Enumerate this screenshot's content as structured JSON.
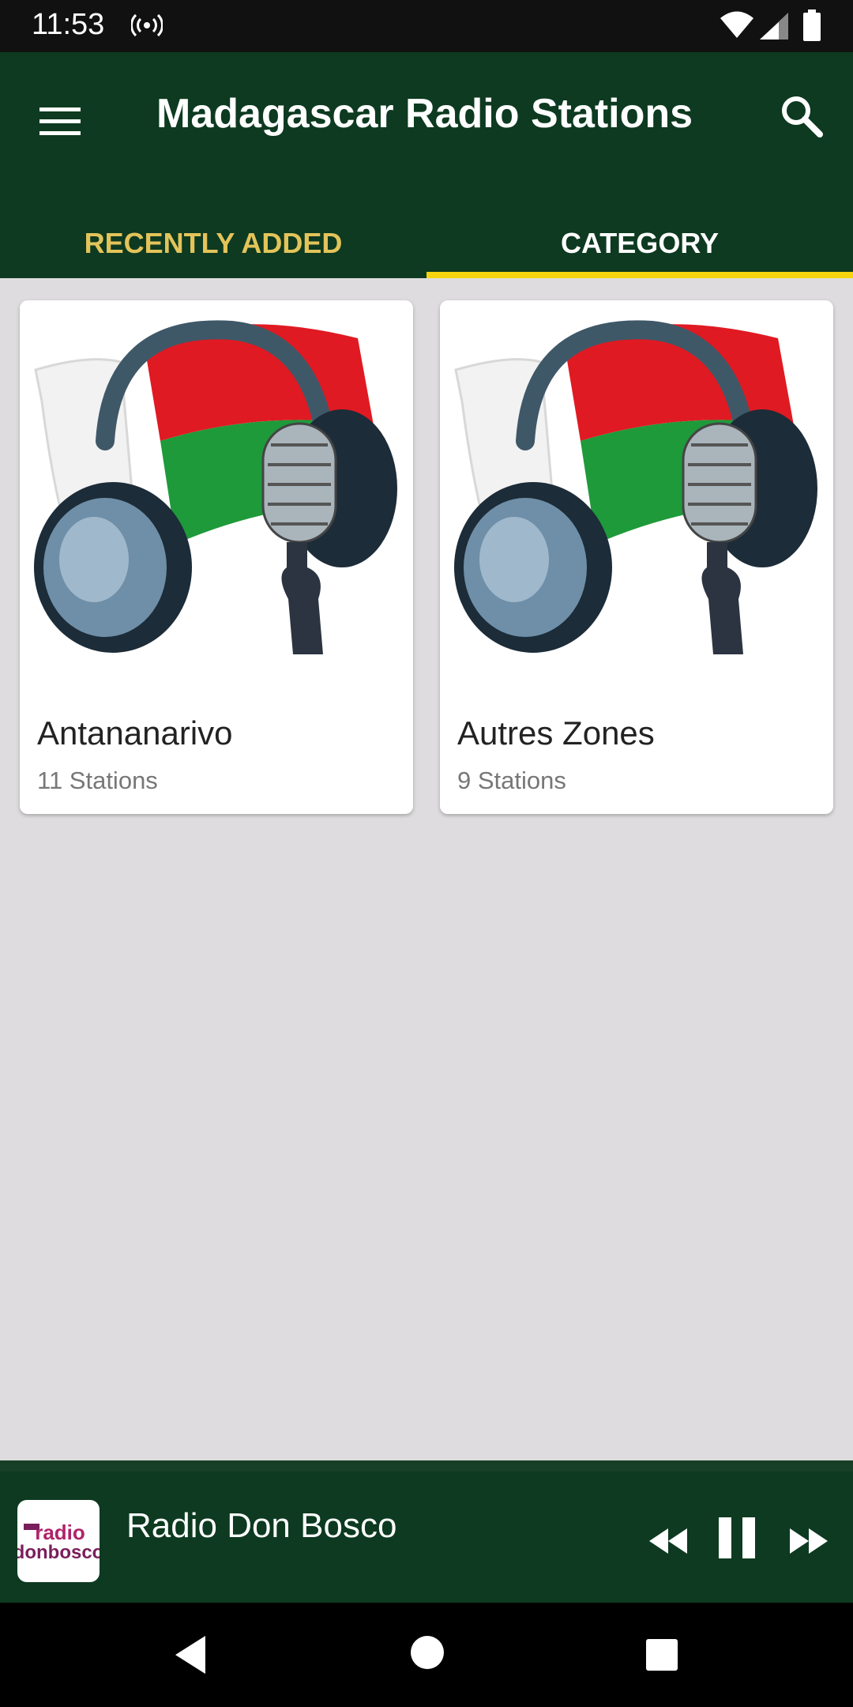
{
  "status_bar": {
    "time": "11:53",
    "icons": [
      "radio-broadcast-icon",
      "wifi-icon",
      "cell-signal-icon",
      "battery-icon"
    ]
  },
  "app_bar": {
    "title": "Madagascar Radio Stations",
    "menu_icon": "hamburger-menu-icon",
    "search_icon": "search-icon",
    "background_color": "#0d3a20"
  },
  "tabs": [
    {
      "label": "RECENTLY ADDED",
      "active": false,
      "color": "#e3c35a"
    },
    {
      "label": "CATEGORY",
      "active": true,
      "color": "#ffffff"
    }
  ],
  "tab_indicator_color": "#f5d50e",
  "categories": [
    {
      "name": "Antananarivo",
      "count": "11 Stations",
      "image_icon": "headphones-microphone-flag-icon"
    },
    {
      "name": "Autres Zones",
      "count": "9 Stations",
      "image_icon": "headphones-microphone-flag-icon"
    }
  ],
  "player": {
    "station": "Radio Don Bosco",
    "logo_text_top": "radio",
    "logo_text_bottom": "donbosco",
    "controls": [
      "rewind-icon",
      "pause-icon",
      "fast-forward-icon"
    ]
  },
  "nav_bar": {
    "buttons": [
      "back-icon",
      "home-icon",
      "recents-icon"
    ]
  }
}
